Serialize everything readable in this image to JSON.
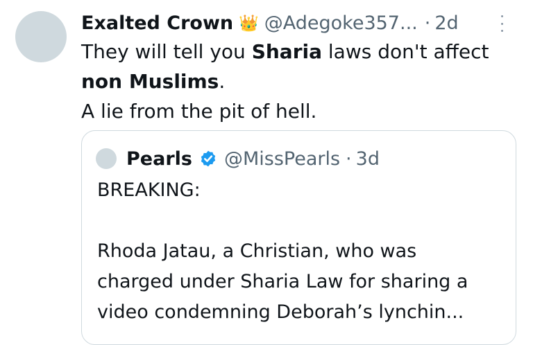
{
  "tweet": {
    "author_name": "Exalted Crown",
    "author_badge_icon": "crown-emoji",
    "handle": "@Adegoke357...",
    "separator": "·",
    "time": "2d",
    "more_icon": "more-vertical-icon",
    "text": {
      "l1_a": "They will tell you ",
      "l1_b": "Sharia",
      "l1_c": " laws don't affect",
      "l2_a": "non Muslims",
      "l2_b": ".",
      "l3": "A lie from the pit of hell."
    }
  },
  "quote": {
    "author_name": "Pearls",
    "verified_icon": "verified-badge-icon",
    "handle": "@MissPearls",
    "separator": "·",
    "time": "3d",
    "text": {
      "l1": "BREAKING:",
      "l3": "Rhoda Jatau, a Christian, who was",
      "l4": "charged under Sharia Law for sharing a",
      "l5": "video condemning Deborah’s lynchin..."
    }
  },
  "colors": {
    "text_primary": "#0f1419",
    "text_secondary": "#536471",
    "border": "#cfd9de",
    "verified_blue": "#1d9bf0",
    "avatar_placeholder": "#cfd9de"
  }
}
